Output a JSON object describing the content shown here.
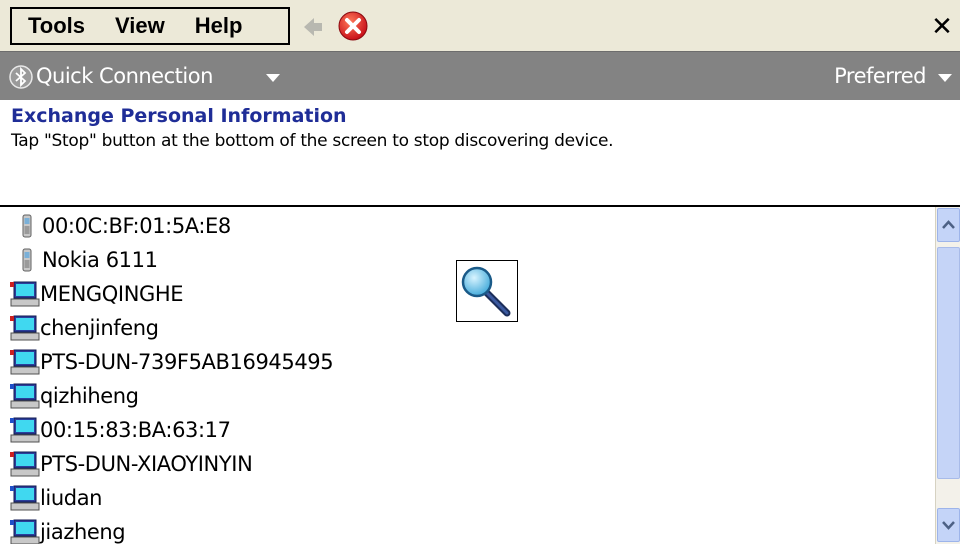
{
  "menubar": {
    "items": [
      "Tools",
      "View",
      "Help"
    ],
    "close_label": "✕"
  },
  "toolbar": {
    "quick_connection_label": "Quick Connection",
    "preferred_label": "Preferred"
  },
  "header": {
    "title": "Exchange Personal Information",
    "subtitle": "Tap \"Stop\" button at the bottom of the screen to stop discovering device."
  },
  "devices": [
    {
      "name": "00:0C:BF:01:5A:E8",
      "icon": "phone-icon"
    },
    {
      "name": "Nokia 6111",
      "icon": "phone-icon"
    },
    {
      "name": "MENGQINGHE",
      "icon": "computer-icon",
      "icon_color": "#cc2020"
    },
    {
      "name": "chenjinfeng",
      "icon": "computer-icon",
      "icon_color": "#cc2020"
    },
    {
      "name": "PTS-DUN-739F5AB16945495",
      "icon": "computer-icon",
      "icon_color": "#cc2020"
    },
    {
      "name": "qizhiheng",
      "icon": "computer-icon",
      "icon_color": "#2050c8"
    },
    {
      "name": "00:15:83:BA:63:17",
      "icon": "computer-icon",
      "icon_color": "#2050c8"
    },
    {
      "name": "PTS-DUN-XIAOYINYIN",
      "icon": "computer-icon",
      "icon_color": "#cc2020"
    },
    {
      "name": "liudan",
      "icon": "computer-icon",
      "icon_color": "#2050c8"
    },
    {
      "name": "jiazheng",
      "icon": "computer-icon",
      "icon_color": "#2050c8"
    }
  ],
  "colors": {
    "title_blue": "#1f2d97",
    "toolbar_gray": "#838383",
    "menubar_beige": "#ece9d8"
  }
}
